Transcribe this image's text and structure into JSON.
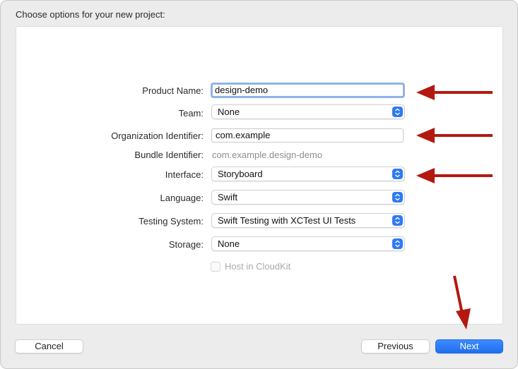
{
  "dialog": {
    "title": "Choose options for your new project:"
  },
  "form": {
    "product_name": {
      "label": "Product Name:",
      "value": "design-demo"
    },
    "team": {
      "label": "Team:",
      "value": "None"
    },
    "organization_identifier": {
      "label": "Organization Identifier:",
      "value": "com.example"
    },
    "bundle_identifier": {
      "label": "Bundle Identifier:",
      "value": "com.example.design-demo"
    },
    "interface": {
      "label": "Interface:",
      "value": "Storyboard"
    },
    "language": {
      "label": "Language:",
      "value": "Swift"
    },
    "testing_system": {
      "label": "Testing System:",
      "value": "Swift Testing with XCTest UI Tests"
    },
    "storage": {
      "label": "Storage:",
      "value": "None"
    },
    "host_in_cloudkit": {
      "label": "Host in CloudKit",
      "checked": false,
      "enabled": false
    }
  },
  "buttons": {
    "cancel": "Cancel",
    "previous": "Previous",
    "next": "Next"
  },
  "annotations": {
    "arrow_color": "#b3190f"
  },
  "colors": {
    "accent": "#2f7af5",
    "focus_ring": "#8fb3e6"
  }
}
